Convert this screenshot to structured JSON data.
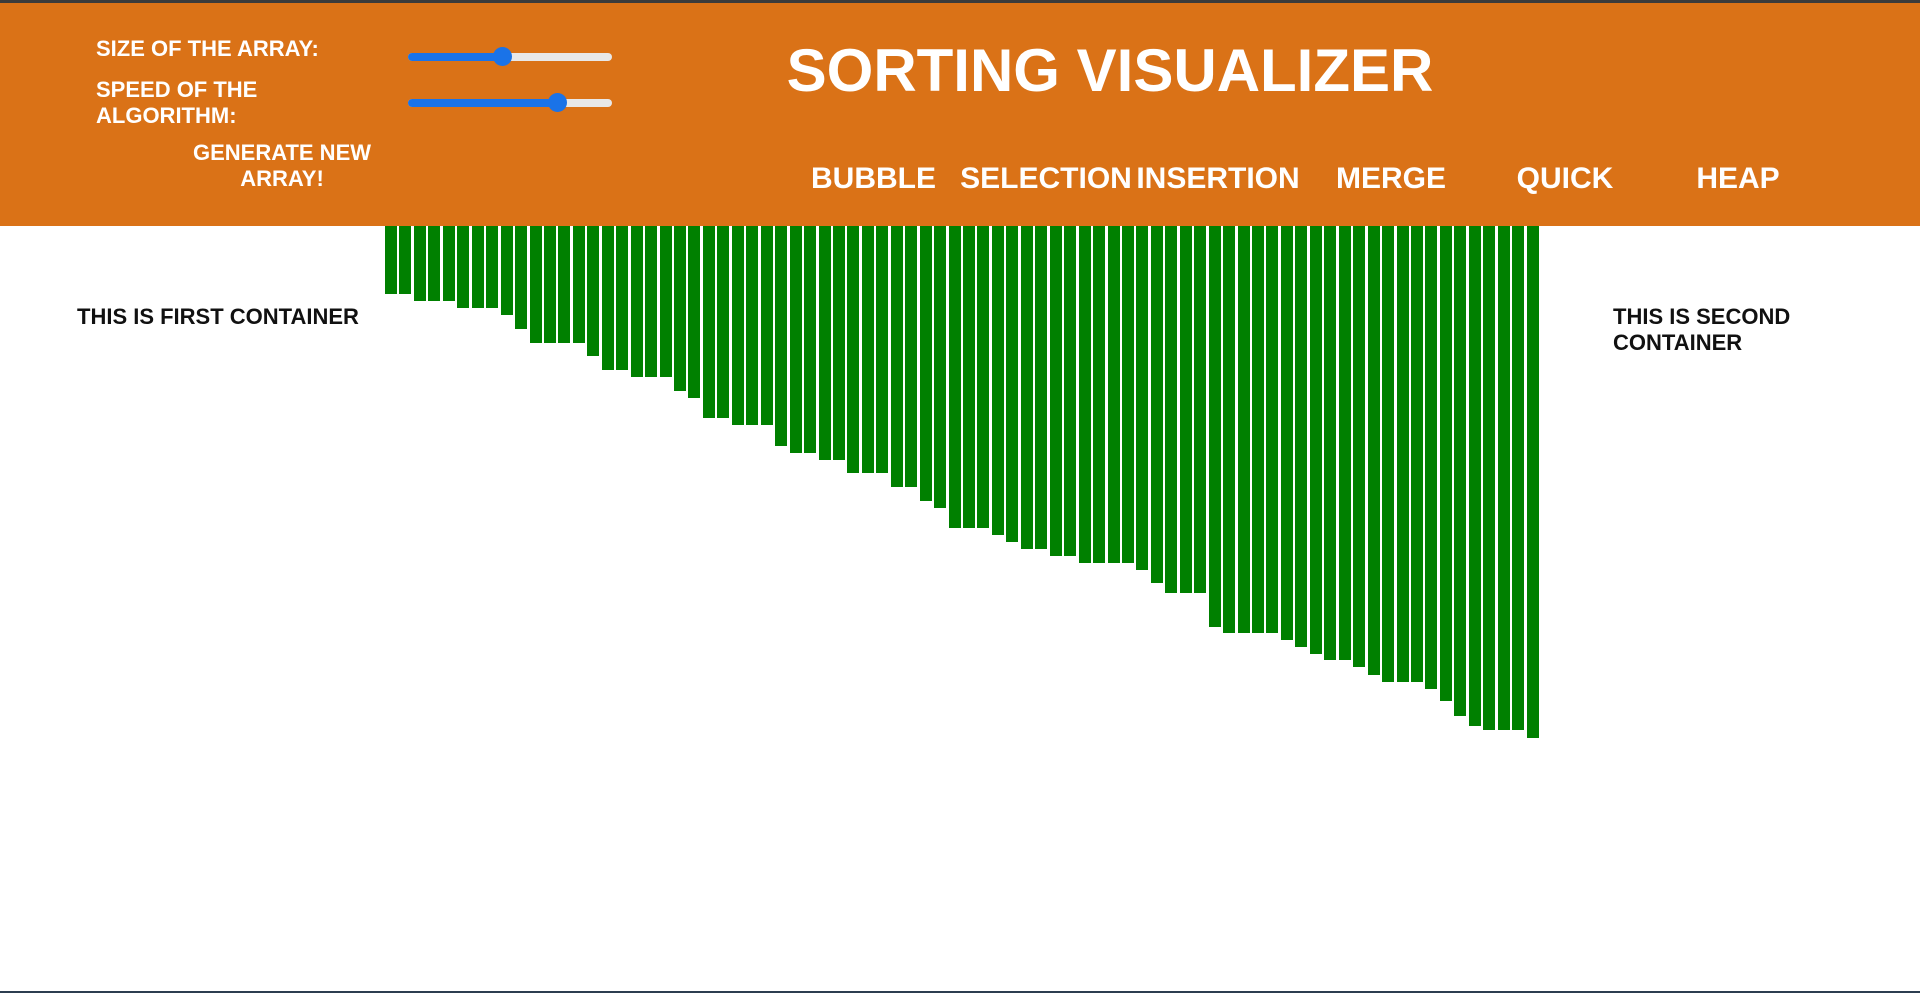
{
  "controls": {
    "size_label": "SIZE OF THE ARRAY:",
    "speed_label": "SPEED OF THE ALGORITHM:",
    "size_value": 0.46,
    "speed_value": 0.73,
    "generate_label": "GENERATE NEW ARRAY!"
  },
  "title": "SORTING VISUALIZER",
  "algorithms": [
    "BUBBLE",
    "SELECTION",
    "INSERTION",
    "MERGE",
    "QUICK",
    "HEAP"
  ],
  "containers": {
    "first": "THIS IS FIRST CONTAINER",
    "second": "THIS IS SECOND CONTAINER"
  },
  "colors": {
    "header": "#da7217",
    "bar": "#008000",
    "slider": "#1a73e8"
  },
  "array": [
    68,
    68,
    75,
    75,
    75,
    82,
    82,
    82,
    89,
    103,
    117,
    117,
    117,
    117,
    130,
    144,
    144,
    151,
    151,
    151,
    165,
    172,
    192,
    192,
    199,
    199,
    199,
    220,
    227,
    227,
    234,
    234,
    247,
    247,
    247,
    261,
    261,
    275,
    282,
    302,
    302,
    302,
    309,
    316,
    323,
    323,
    330,
    330,
    337,
    337,
    337,
    337,
    344,
    357,
    367,
    367,
    367,
    401,
    407,
    407,
    407,
    407,
    414,
    421,
    428,
    434,
    434,
    441,
    449,
    456,
    456,
    456,
    463,
    475,
    490,
    500,
    504,
    504,
    504,
    512
  ]
}
